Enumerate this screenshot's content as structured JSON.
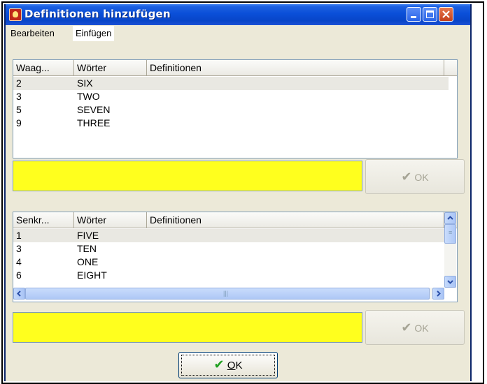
{
  "window": {
    "title": "Definitionen hinzufügen"
  },
  "menu": {
    "edit": "Bearbeiten",
    "insert": "Einfügen"
  },
  "across_list": {
    "headers": [
      "Waag...",
      "Wörter",
      "Definitionen"
    ],
    "rows": [
      {
        "num": "2",
        "word": "SIX"
      },
      {
        "num": "3",
        "word": "TWO"
      },
      {
        "num": "5",
        "word": "SEVEN"
      },
      {
        "num": "9",
        "word": "THREE"
      }
    ]
  },
  "down_list": {
    "headers": [
      "Senkr...",
      "Wörter",
      "Definitionen"
    ],
    "rows": [
      {
        "num": "1",
        "word": "FIVE"
      },
      {
        "num": "3",
        "word": "TEN"
      },
      {
        "num": "4",
        "word": "ONE"
      },
      {
        "num": "6",
        "word": "EIGHT"
      }
    ]
  },
  "definition_fields": {
    "across_value": "",
    "down_value": ""
  },
  "buttons": {
    "side_ok": "OK",
    "main_ok": "OK",
    "main_ok_mnemonic": "O",
    "main_ok_rest": "K"
  },
  "icons": {
    "check": "✔"
  },
  "colors": {
    "title_bar": "#0a4fd8",
    "definition_field": "#ffff1e",
    "check": "#21a121"
  }
}
